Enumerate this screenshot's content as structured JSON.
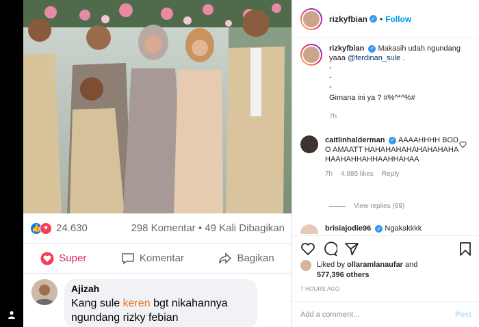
{
  "post": {
    "username": "rizkyfbian",
    "follow_label": "Follow",
    "separator": "•",
    "caption_line1": "Makasih udah ngundang yaaa",
    "caption_mention": "@ferdinan_sule",
    "caption_dot": ".",
    "caption_dash1": "-",
    "caption_dash2": "-",
    "caption_dash3": "-",
    "caption_line2": "Gimana ini ya ? #%^*^%#",
    "caption_time": "7h"
  },
  "comments": [
    {
      "username": "caitlinhalderman",
      "text": "AAAAHHHH BODO AMAATT HAHAHAHAHAHAHAHAHAHAAHAHHAHHAAHHAHAA",
      "time": "7h",
      "likes": "4,985 likes",
      "reply_label": "Reply",
      "view_replies": "View replies (69)"
    },
    {
      "username": "brisiajodie96",
      "text": "Ngakakkkk"
    }
  ],
  "likes": {
    "prefix": "Liked by",
    "user": "ollaramlanaufar",
    "and": "and",
    "count": "577,396 others"
  },
  "posted_time": "7 HOURS AGO",
  "add_comment": {
    "placeholder": "Add a comment...",
    "post_label": "Post"
  },
  "fb_screenshot": {
    "reaction_count": "24.630",
    "comments_shares": "298 Komentar • 49 Kali Dibagikan",
    "super_label": "Super",
    "comment_label": "Komentar",
    "share_label": "Bagikan",
    "commenter": "Ajizah",
    "comment_pre": "Kang sule",
    "comment_highlight": "keren",
    "comment_post": "bgt nikahannya ngundang rizky febian"
  },
  "colors": {
    "follow": "#0095f6",
    "verified": "#3897f0",
    "fb_super": "#e0245e",
    "highlight": "#e8711c"
  },
  "icons": [
    "heart-icon",
    "comment-icon",
    "share-icon",
    "bookmark-icon",
    "verified-icon",
    "user-icon",
    "like-reaction-icon",
    "love-reaction-icon"
  ]
}
